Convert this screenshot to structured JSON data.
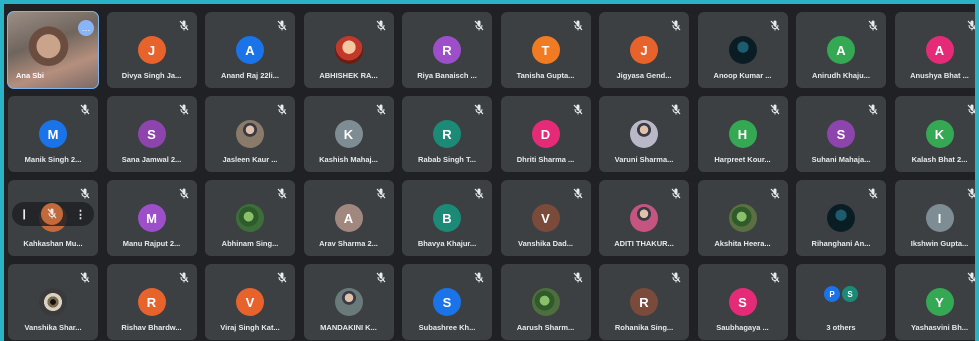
{
  "participants": [
    {
      "name": "Ana Sbi",
      "initial": "",
      "color": "",
      "photo": "self",
      "self": true
    },
    {
      "name": "Divya Singh Ja...",
      "initial": "J",
      "color": "#e8622c"
    },
    {
      "name": "Anand Raj 22li...",
      "initial": "A",
      "color": "#1a73e8"
    },
    {
      "name": "ABHISHEK RA...",
      "initial": "",
      "color": "#c0392b",
      "photo": "cartoon"
    },
    {
      "name": "Riya Banaisch ...",
      "initial": "R",
      "color": "#9c4fc8"
    },
    {
      "name": "Tanisha Gupta...",
      "initial": "T",
      "color": "#f07b22"
    },
    {
      "name": "Jigyasa Gend...",
      "initial": "J",
      "color": "#e8622c"
    },
    {
      "name": "Anoop Kumar ...",
      "initial": "",
      "color": "#12343f",
      "photo": "dark"
    },
    {
      "name": "Anirudh Khaju...",
      "initial": "A",
      "color": "#34a853"
    },
    {
      "name": "Anushya Bhat ...",
      "initial": "A",
      "color": "#e52b78"
    },
    {
      "name": "Manik Singh 2...",
      "initial": "M",
      "color": "#1a73e8"
    },
    {
      "name": "Sana Jamwal 2...",
      "initial": "S",
      "color": "#8e44ad"
    },
    {
      "name": "Jasleen Kaur ...",
      "initial": "",
      "color": "#8a7a6a",
      "photo": "person"
    },
    {
      "name": "Kashish Mahaj...",
      "initial": "K",
      "color": "#7e8c94"
    },
    {
      "name": "Rabab Singh T...",
      "initial": "R",
      "color": "#1b8a76"
    },
    {
      "name": "Dhriti Sharma ...",
      "initial": "D",
      "color": "#e52b78"
    },
    {
      "name": "Varuni Sharma...",
      "initial": "",
      "color": "#b8b8c8",
      "photo": "person"
    },
    {
      "name": "Harpreet Kour...",
      "initial": "H",
      "color": "#34a853"
    },
    {
      "name": "Suhani Mahaja...",
      "initial": "S",
      "color": "#8e44ad"
    },
    {
      "name": "Kalash Bhat 2...",
      "initial": "K",
      "color": "#34a853"
    },
    {
      "name": "Kahkashan Mu...",
      "initial": "K",
      "color": "#c26a3c",
      "hover": true
    },
    {
      "name": "Manu Rajput 2...",
      "initial": "M",
      "color": "#9c4fc8"
    },
    {
      "name": "Abhinam Sing...",
      "initial": "",
      "color": "#3c6e3a",
      "photo": "plant"
    },
    {
      "name": "Arav Sharma 2...",
      "initial": "A",
      "color": "#a1887f"
    },
    {
      "name": "Bhavya Khajur...",
      "initial": "B",
      "color": "#1b8a76"
    },
    {
      "name": "Vanshika Dad...",
      "initial": "V",
      "color": "#7a4a3a"
    },
    {
      "name": "ADITI THAKUR...",
      "initial": "",
      "color": "#c45580",
      "photo": "person"
    },
    {
      "name": "Akshita Heera...",
      "initial": "",
      "color": "#5a7040",
      "photo": "plant"
    },
    {
      "name": "Rihanghani An...",
      "initial": "",
      "color": "#2a2a2a",
      "photo": "dark"
    },
    {
      "name": "Ikshwin Gupta...",
      "initial": "I",
      "color": "#7e8c94"
    },
    {
      "name": "Vanshika Shar...",
      "initial": "",
      "color": "#3a3a3a",
      "photo": "eye"
    },
    {
      "name": "Rishav Bhardw...",
      "initial": "R",
      "color": "#e8622c"
    },
    {
      "name": "Viraj Singh Kat...",
      "initial": "V",
      "color": "#e8622c"
    },
    {
      "name": "MANDAKINI K...",
      "initial": "",
      "color": "#6a7a7a",
      "photo": "person"
    },
    {
      "name": "Subashree Kh...",
      "initial": "S",
      "color": "#1a73e8"
    },
    {
      "name": "Aarush Sharm...",
      "initial": "",
      "color": "#4e6e3e",
      "photo": "plant"
    },
    {
      "name": "Rohanika Sing...",
      "initial": "R",
      "color": "#7a4a3a"
    },
    {
      "name": "Saubhagaya ...",
      "initial": "S",
      "color": "#e52b78"
    },
    {
      "name": "3 others",
      "initial": "",
      "color": "",
      "others": [
        {
          "initial": "P",
          "color": "#1a73e8"
        },
        {
          "initial": "S",
          "color": "#1b8a76"
        }
      ]
    },
    {
      "name": "Yashasvini Bh...",
      "initial": "Y",
      "color": "#34a853"
    }
  ]
}
